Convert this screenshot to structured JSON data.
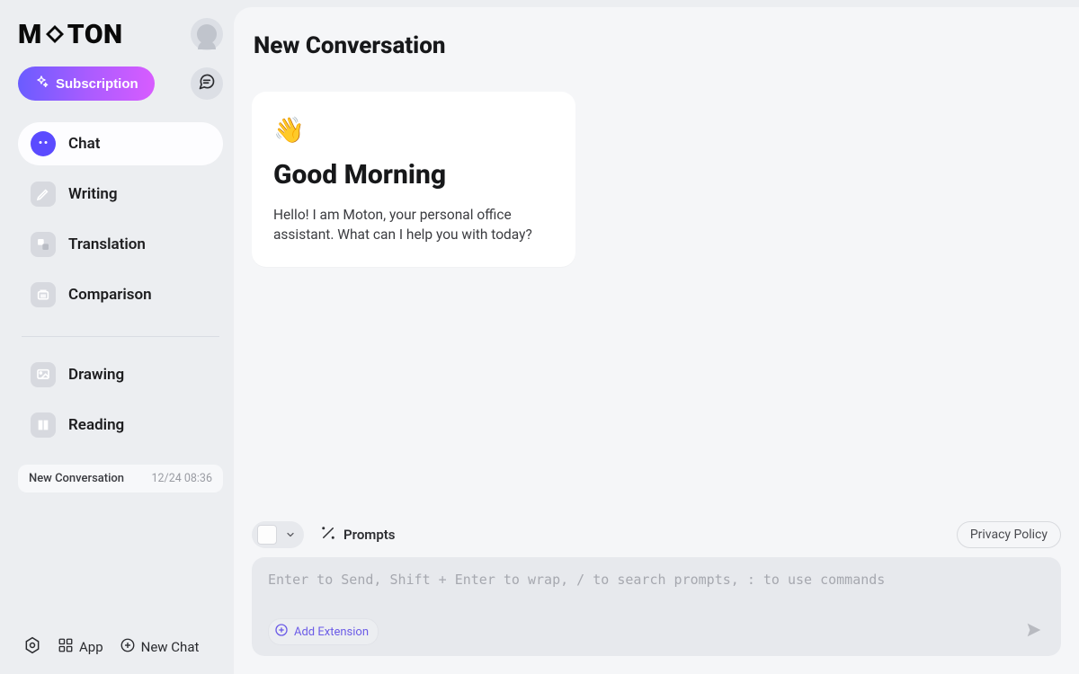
{
  "brand": {
    "name_before": "M",
    "name_after": "TON"
  },
  "subscription_label": "Subscription",
  "nav": {
    "items": [
      {
        "label": "Chat"
      },
      {
        "label": "Writing"
      },
      {
        "label": "Translation"
      },
      {
        "label": "Comparison"
      },
      {
        "label": "Drawing"
      },
      {
        "label": "Reading"
      }
    ]
  },
  "history": {
    "item_title": "New Conversation",
    "item_date": "12/24 08:36"
  },
  "footer": {
    "app": "App",
    "new_chat": "New Chat"
  },
  "main": {
    "title": "New Conversation",
    "greeting_emoji": "👋",
    "greeting_title": "Good Morning",
    "greeting_text": "Hello! I am Moton, your personal office assistant. What can I help you with today?"
  },
  "toolbar": {
    "prompts": "Prompts",
    "privacy": "Privacy Policy"
  },
  "composer": {
    "placeholder": "Enter to Send, Shift + Enter to wrap, / to search prompts, : to use commands",
    "add_extension": "Add Extension"
  }
}
